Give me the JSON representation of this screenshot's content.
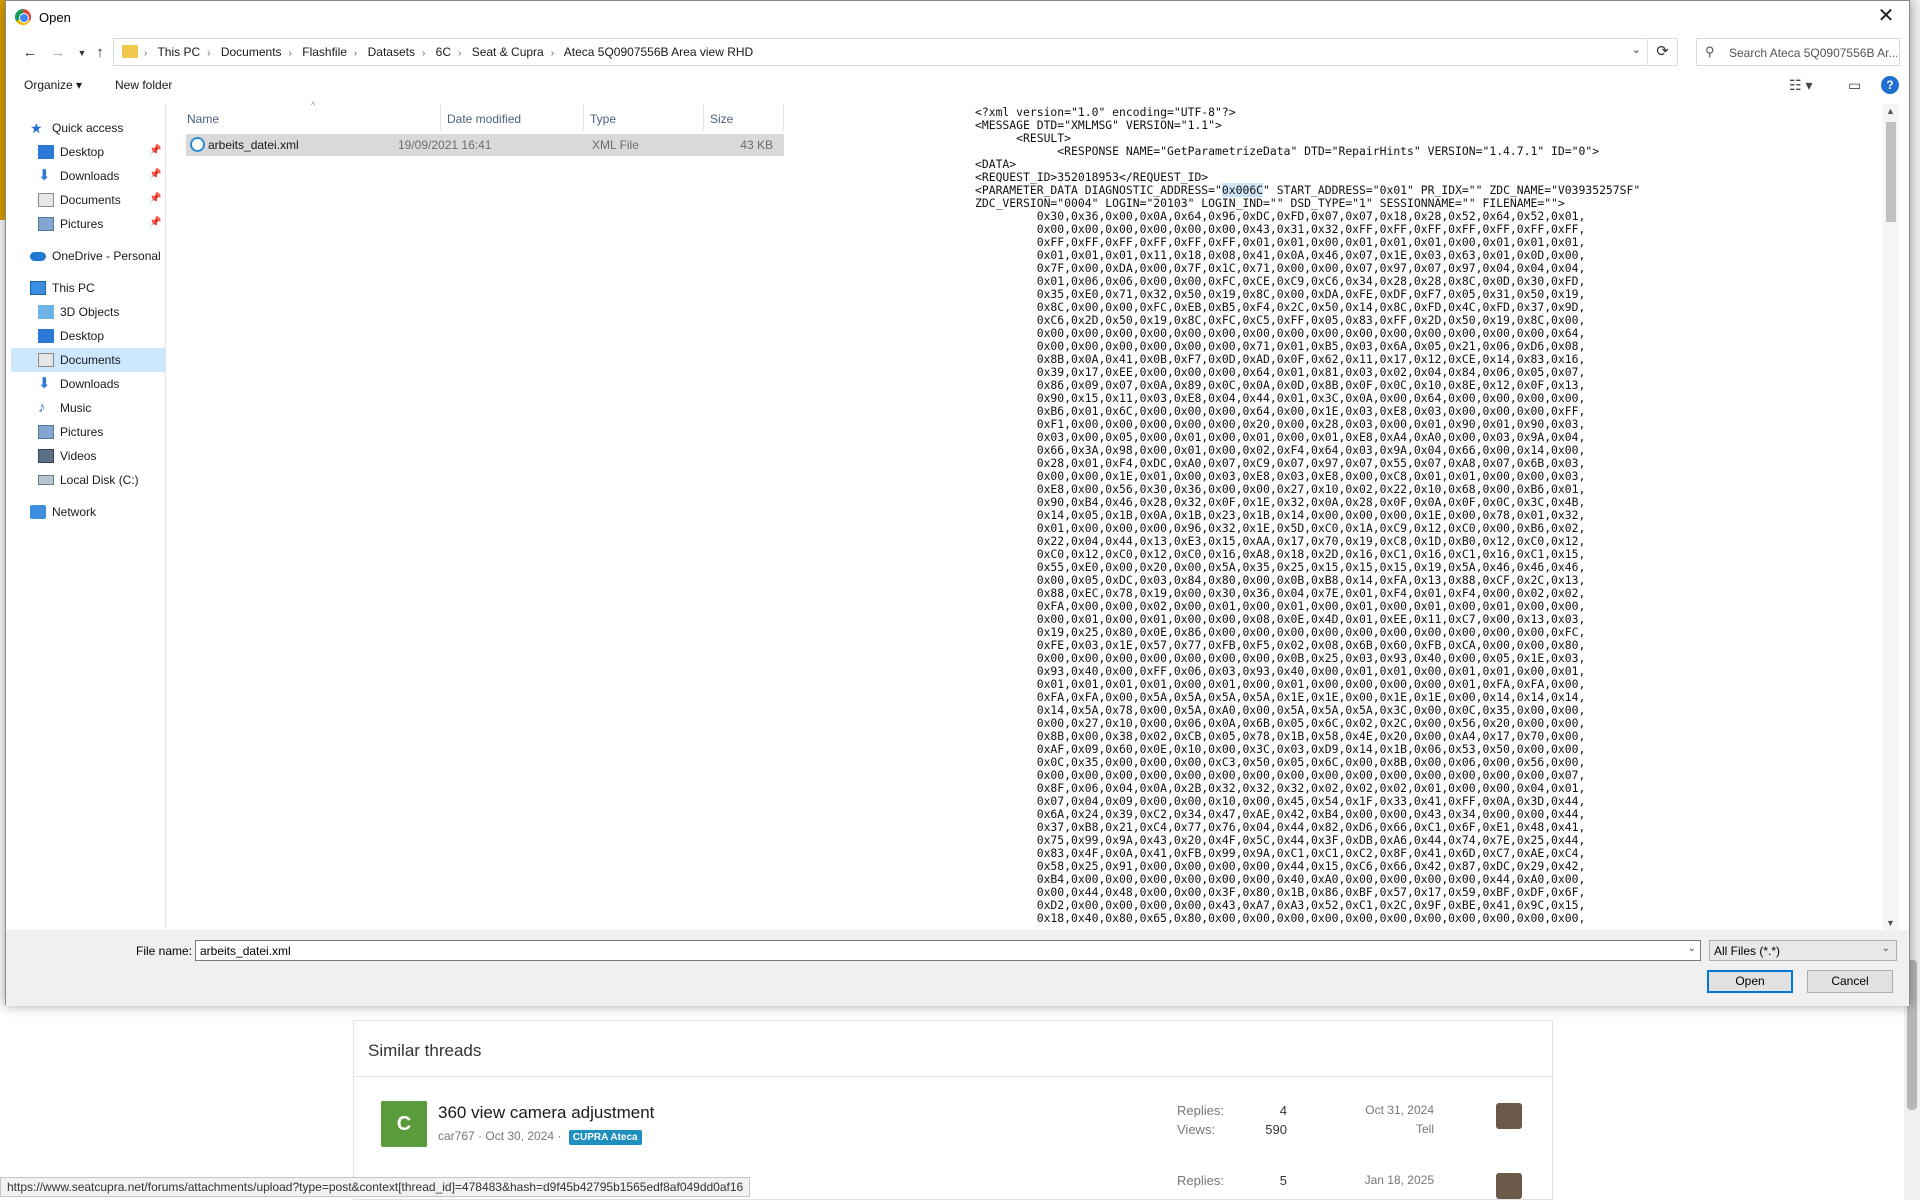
{
  "dialog": {
    "title": "Open",
    "close_glyph": "✕",
    "address": {
      "crumbs": [
        "This PC",
        "Documents",
        "Flashfile",
        "Datasets",
        "6C",
        "Seat & Cupra",
        "Ateca 5Q0907556B Area view RHD"
      ],
      "refresh_glyph": "⟳"
    },
    "search_placeholder": "Search Ateca 5Q0907556B Ar...",
    "toolbar": {
      "organize": "Organize ▾",
      "new_folder": "New folder"
    },
    "nav": {
      "quick_access": "Quick access",
      "qa_desktop": "Desktop",
      "qa_downloads": "Downloads",
      "qa_documents": "Documents",
      "qa_pictures": "Pictures",
      "onedrive": "OneDrive - Personal",
      "this_pc": "This PC",
      "objects3d": "3D Objects",
      "desktop": "Desktop",
      "documents": "Documents",
      "downloads": "Downloads",
      "music": "Music",
      "pictures": "Pictures",
      "videos": "Videos",
      "local_disk": "Local Disk (C:)",
      "network": "Network"
    },
    "columns": {
      "name": "Name",
      "date": "Date modified",
      "type": "Type",
      "size": "Size"
    },
    "file": {
      "name": "arbeits_datei.xml",
      "date": "19/09/2021 16:41",
      "type": "XML File",
      "size": "43 KB"
    },
    "preview": {
      "line1": "<?xml version=\"1.0\" encoding=\"UTF-8\"?>",
      "line2": "<MESSAGE DTD=\"XMLMSG\" VERSION=\"1.1\">",
      "line3": "      <RESULT>",
      "line4": "            <RESPONSE NAME=\"GetParametrizeData\" DTD=\"RepairHints\" VERSION=\"1.4.7.1\" ID=\"0\">",
      "line5": "<DATA>",
      "line6": "<REQUEST_ID>352018953</REQUEST_ID>",
      "line7a": "<PARAMETER_DATA DIAGNOSTIC_ADDRESS=\"",
      "line7hl": "0x006C",
      "line7b": "\" START_ADDRESS=\"0x01\" PR_IDX=\"\" ZDC_NAME=\"V03935257SF\"",
      "line8": "ZDC_VERSION=\"0004\" LOGIN=\"20103\" LOGIN_IND=\"\" DSD_TYPE=\"1\" SESSIONNAME=\"\" FILENAME=\"\">",
      "hex": [
        "0x30,0x36,0x00,0x0A,0x64,0x96,0xDC,0xFD,0x07,0x07,0x18,0x28,0x52,0x64,0x52,0x01,",
        "0x00,0x00,0x00,0x00,0x00,0x00,0x43,0x31,0x32,0xFF,0xFF,0xFF,0xFF,0xFF,0xFF,0xFF,",
        "0xFF,0xFF,0xFF,0xFF,0xFF,0xFF,0x01,0x01,0x00,0x01,0x01,0x01,0x00,0x01,0x01,0x01,",
        "0x01,0x01,0x01,0x11,0x18,0x08,0x41,0x0A,0x46,0x07,0x1E,0x03,0x63,0x01,0x0D,0x00,",
        "0x7F,0x00,0xDA,0x00,0x7F,0x1C,0x71,0x00,0x00,0x07,0x97,0x07,0x97,0x04,0x04,0x04,",
        "0x01,0x06,0x06,0x00,0x00,0xFC,0xCE,0xC9,0xC6,0x34,0x28,0x28,0x8C,0x0D,0x30,0xFD,",
        "0x35,0xE0,0x71,0x32,0x50,0x19,0x8C,0x00,0xDA,0xFE,0xDF,0xF7,0x05,0x31,0x50,0x19,",
        "0x8C,0x00,0x00,0xFC,0xEB,0xB5,0xF4,0x2C,0x50,0x14,0x8C,0xFD,0x4C,0xFD,0x37,0x9D,",
        "0xC6,0x2D,0x50,0x19,0x8C,0xFC,0xC5,0xFF,0x05,0x83,0xFF,0x2D,0x50,0x19,0x8C,0x00,",
        "0x00,0x00,0x00,0x00,0x00,0x00,0x00,0x00,0x00,0x00,0x00,0x00,0x00,0x00,0x00,0x64,",
        "0x00,0x00,0x00,0x00,0x00,0x00,0x71,0x01,0xB5,0x03,0x6A,0x05,0x21,0x06,0xD6,0x08,",
        "0x8B,0x0A,0x41,0x0B,0xF7,0x0D,0xAD,0x0F,0x62,0x11,0x17,0x12,0xCE,0x14,0x83,0x16,",
        "0x39,0x17,0xEE,0x00,0x00,0x00,0x64,0x01,0x81,0x03,0x02,0x04,0x84,0x06,0x05,0x07,",
        "0x86,0x09,0x07,0x0A,0x89,0x0C,0x0A,0x0D,0x8B,0x0F,0x0C,0x10,0x8E,0x12,0x0F,0x13,",
        "0x90,0x15,0x11,0x03,0xE8,0x04,0x44,0x01,0x3C,0x0A,0x00,0x64,0x00,0x00,0x00,0x00,",
        "0xB6,0x01,0x6C,0x00,0x00,0x00,0x64,0x00,0x1E,0x03,0xE8,0x03,0x00,0x00,0x00,0xFF,",
        "0xF1,0x00,0x00,0x00,0x00,0x00,0x20,0x00,0x28,0x03,0x00,0x01,0x90,0x01,0x90,0x03,",
        "0x03,0x00,0x05,0x00,0x01,0x00,0x01,0x00,0x01,0xE8,0xA4,0xA0,0x00,0x03,0x9A,0x04,",
        "0x66,0x3A,0x98,0x00,0x01,0x00,0x02,0xF4,0x64,0x03,0x9A,0x04,0x66,0x00,0x14,0x00,",
        "0x28,0x01,0xF4,0xDC,0xA0,0x07,0xC9,0x07,0x97,0x07,0x55,0x07,0xA8,0x07,0x6B,0x03,",
        "0x00,0x00,0x1E,0x01,0x00,0x03,0xE8,0x03,0xE8,0x00,0xC8,0x01,0x01,0x00,0x00,0x03,",
        "0xE8,0x00,0x56,0x30,0x36,0x00,0x00,0x27,0x10,0x02,0x22,0x10,0x68,0x00,0xB6,0x01,",
        "0x90,0xB4,0x46,0x28,0x32,0x0F,0x1E,0x32,0x0A,0x28,0x0F,0x0A,0x0F,0x0C,0x3C,0x4B,",
        "0x14,0x05,0x1B,0x0A,0x1B,0x23,0x1B,0x14,0x00,0x00,0x00,0x1E,0x00,0x78,0x01,0x32,",
        "0x01,0x00,0x00,0x00,0x96,0x32,0x1E,0x5D,0xC0,0x1A,0xC9,0x12,0xC0,0x00,0xB6,0x02,",
        "0x22,0x04,0x44,0x13,0xE3,0x15,0xAA,0x17,0x70,0x19,0xC8,0x1D,0xB0,0x12,0xC0,0x12,",
        "0xC0,0x12,0xC0,0x12,0xC0,0x16,0xA8,0x18,0x2D,0x16,0xC1,0x16,0xC1,0x16,0xC1,0x15,",
        "0x55,0xE0,0x00,0x20,0x00,0x5A,0x35,0x25,0x15,0x15,0x15,0x19,0x5A,0x46,0x46,0x46,",
        "0x00,0x05,0xDC,0x03,0x84,0x80,0x00,0x0B,0xB8,0x14,0xFA,0x13,0x88,0xCF,0x2C,0x13,",
        "0x88,0xEC,0x78,0x19,0x00,0x30,0x36,0x04,0x7E,0x01,0xF4,0x01,0xF4,0x00,0x02,0x02,",
        "0xFA,0x00,0x00,0x02,0x00,0x01,0x00,0x01,0x00,0x01,0x00,0x01,0x00,0x01,0x00,0x00,",
        "0x00,0x01,0x00,0x01,0x00,0x00,0x08,0x0E,0x4D,0x01,0xEE,0x11,0xC7,0x00,0x13,0x03,",
        "0x19,0x25,0x80,0x0E,0x86,0x00,0x00,0x00,0x00,0x00,0x00,0x00,0x00,0x00,0x00,0xFC,",
        "0xFE,0x03,0x1E,0x57,0x77,0xFB,0xF5,0x02,0x08,0x6B,0x60,0xFB,0xCA,0x00,0x00,0x80,",
        "0x00,0x00,0x00,0x00,0x00,0x00,0x00,0x0B,0x25,0x03,0x93,0x40,0x00,0x05,0x1E,0x03,",
        "0x93,0x40,0x00,0xFF,0x06,0x03,0x93,0x40,0x00,0x01,0x01,0x00,0x01,0x01,0x00,0x01,",
        "0x01,0x01,0x01,0x01,0x00,0x01,0x00,0x01,0x00,0x00,0x00,0x00,0x01,0xFA,0xFA,0x00,",
        "0xFA,0xFA,0x00,0x5A,0x5A,0x5A,0x5A,0x1E,0x1E,0x00,0x1E,0x1E,0x00,0x14,0x14,0x14,",
        "0x14,0x5A,0x78,0x00,0x5A,0xA0,0x00,0x5A,0x5A,0x5A,0x3C,0x00,0x0C,0x35,0x00,0x00,",
        "0x00,0x27,0x10,0x00,0x06,0x0A,0x6B,0x05,0x6C,0x02,0x2C,0x00,0x56,0x20,0x00,0x00,",
        "0x8B,0x00,0x38,0x02,0xCB,0x05,0x78,0x1B,0x58,0x4E,0x20,0x00,0xA4,0x17,0x70,0x00,",
        "0xAF,0x09,0x60,0x0E,0x10,0x00,0x3C,0x03,0xD9,0x14,0x1B,0x06,0x53,0x50,0x00,0x00,",
        "0x0C,0x35,0x00,0x00,0x00,0xC3,0x50,0x05,0x6C,0x00,0x8B,0x00,0x06,0x00,0x56,0x00,",
        "0x00,0x00,0x00,0x00,0x00,0x00,0x00,0x00,0x00,0x00,0x00,0x00,0x00,0x00,0x00,0x07,",
        "0x8F,0x06,0x04,0x0A,0x2B,0x32,0x32,0x32,0x02,0x02,0x02,0x01,0x00,0x00,0x04,0x01,",
        "0x07,0x04,0x09,0x00,0x00,0x10,0x00,0x45,0x54,0x1F,0x33,0x41,0xFF,0x0A,0x3D,0x44,",
        "0x6A,0x24,0x39,0xC2,0x34,0x47,0xAE,0x42,0xB4,0x00,0x00,0x43,0x34,0x00,0x00,0x44,",
        "0x37,0xB8,0x21,0xC4,0x77,0x76,0x04,0x44,0x82,0xD6,0x66,0xC1,0x6F,0xE1,0x48,0x41,",
        "0x75,0x99,0x9A,0x43,0x20,0x4F,0x5C,0x44,0x3F,0xDB,0xA6,0x44,0x74,0x7E,0x25,0x44,",
        "0x83,0x4F,0x0A,0x41,0xFB,0x99,0x9A,0xC1,0xC1,0xC2,0x8F,0x41,0x6D,0xC7,0xAE,0xC4,",
        "0x58,0x25,0x91,0x00,0x00,0x00,0x00,0x44,0x15,0xC6,0x66,0x42,0x87,0xDC,0x29,0x42,",
        "0xB4,0x00,0x00,0x00,0x00,0x00,0x00,0x40,0xA0,0x00,0x00,0x00,0x00,0x44,0xA0,0x00,",
        "0x00,0x44,0x48,0x00,0x00,0x3F,0x80,0x1B,0x86,0xBF,0x57,0x17,0x59,0xBF,0xDF,0x6F,",
        "0xD2,0x00,0x00,0x00,0x00,0x43,0xA7,0xA3,0x52,0xC1,0x2C,0x9F,0xBE,0x41,0x9C,0x15,",
        "0x18,0x40,0x80,0x65,0x80,0x00,0x00,0x00,0x00,0x00,0x00,0x00,0x00,0x00,0x00,0x00,"
      ]
    },
    "footer": {
      "file_name_label": "File name:",
      "file_name_value": "arbeits_datei.xml",
      "file_type": "All Files (*.*)",
      "open": "Open",
      "cancel": "Cancel"
    }
  },
  "background": {
    "similar_threads": "Similar threads",
    "thread1": {
      "avatar": "C",
      "title": "360 view camera adjustment",
      "author_date": "car767 · Oct 30, 2024 ·",
      "tag": "CUPRA Ateca",
      "replies_label": "Replies:",
      "replies": "4",
      "views_label": "Views:",
      "views": "590",
      "last_date": "Oct 31, 2024",
      "last_user": "Tell"
    },
    "thread2": {
      "replies_label": "Replies:",
      "replies": "5",
      "last_date": "Jan 18, 2025"
    },
    "status_url": "https://www.seatcupra.net/forums/attachments/upload?type=post&context[thread_id]=478483&hash=d9f45b42795b1565edf8af049dd0af16"
  }
}
